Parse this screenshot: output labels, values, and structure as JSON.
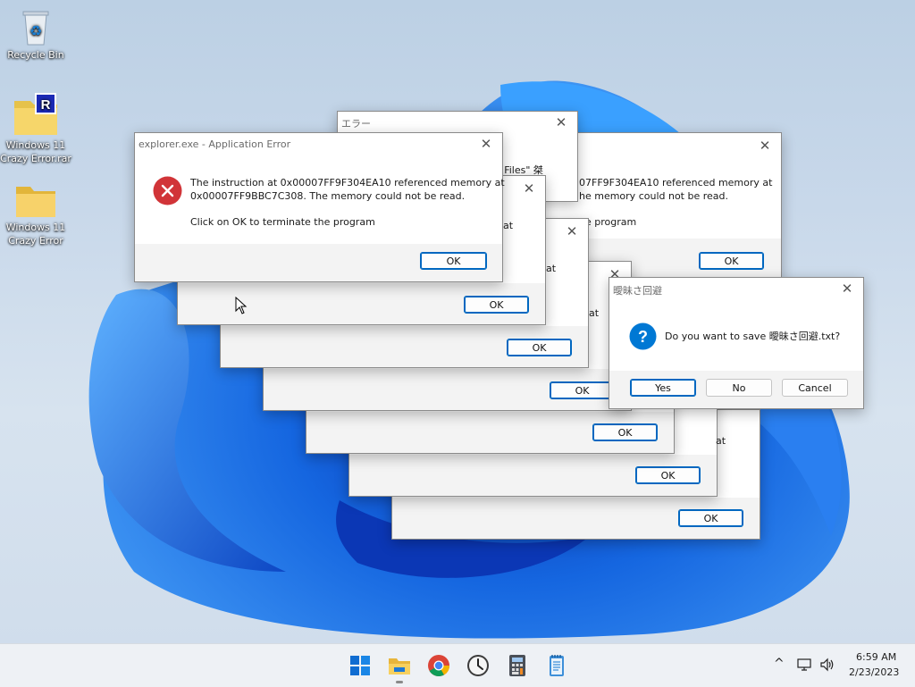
{
  "desktop": {
    "icons": [
      {
        "label": "Recycle Bin"
      },
      {
        "label_line1": "Windows 11",
        "label_line2": "Crazy Error.rar"
      },
      {
        "label_line1": "Windows 11",
        "label_line2": "Crazy Error"
      }
    ]
  },
  "dialogs": {
    "japanese_error": {
      "title": "エラー",
      "fragment": "m Files\" 桀"
    },
    "back_error": {
      "text1": "07FF9F304EA10 referenced memory at",
      "text2": "he memory could not be read.",
      "text3": "he program",
      "ok": "OK"
    },
    "stack_fragment": "at",
    "stack_ok": "OK",
    "main_error": {
      "title": "explorer.exe - Application Error",
      "line1": "The instruction at 0x00007FF9F304EA10 referenced memory at",
      "line2": "0x00007FF9BBC7C308. The memory could not be read.",
      "line3": "Click on OK to terminate the program",
      "ok": "OK"
    },
    "save_prompt": {
      "title": "曖昧さ回避",
      "message": "Do you want to save 曖昧さ回避.txt?",
      "yes": "Yes",
      "no": "No",
      "cancel": "Cancel"
    }
  },
  "close_glyph": "✕",
  "taskbar": {
    "apps": [
      "start-icon",
      "file-explorer-icon",
      "chrome-icon",
      "clock-app-icon",
      "calculator-icon",
      "notepad-icon"
    ],
    "time": "6:59 AM",
    "date": "2/23/2023",
    "chevron": "^"
  },
  "colors": {
    "error_red": "#d13438",
    "question_blue": "#0078d4",
    "accent": "#0067c0"
  }
}
